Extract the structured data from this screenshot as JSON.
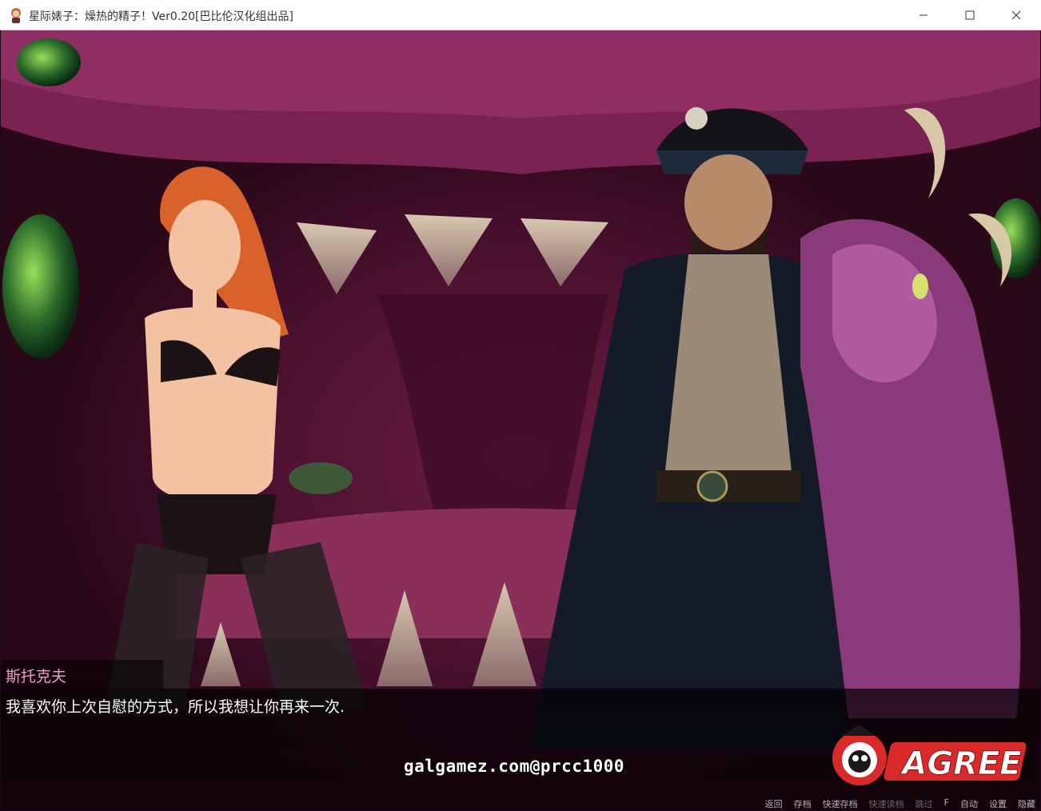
{
  "window": {
    "title": "星际婊子：燥热的精子！Ver0.20[巴比伦汉化组出品]",
    "controls": [
      "minimize",
      "maximize",
      "close"
    ]
  },
  "dialogue": {
    "speaker": "斯托克夫",
    "speaker_color": "#e8a0c8",
    "text": "我喜欢你上次自慰的方式，所以我想让你再来一次."
  },
  "overlay": {
    "watermark": "galgamez.com@prcc1000",
    "logo_text": "AGREE"
  },
  "quick_menu": [
    {
      "label": "返回",
      "enabled": true
    },
    {
      "label": "存档",
      "enabled": true
    },
    {
      "label": "快速存档",
      "enabled": true
    },
    {
      "label": "快速读档",
      "enabled": false
    },
    {
      "label": "跳过",
      "enabled": false
    },
    {
      "label": "F",
      "enabled": true
    },
    {
      "label": "自动",
      "enabled": true
    },
    {
      "label": "设置",
      "enabled": true
    },
    {
      "label": "隐藏",
      "enabled": true
    }
  ],
  "colors": {
    "background": "#5a1638",
    "accent": "#e8a0c8"
  }
}
